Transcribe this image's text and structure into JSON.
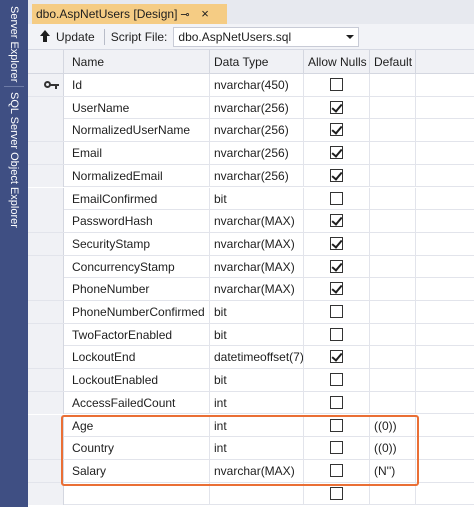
{
  "side_panel": {
    "tabs": [
      "Server Explorer",
      "SQL Server Object Explorer"
    ]
  },
  "document_tab": {
    "title": "dbo.AspNetUsers [Design]",
    "pin_glyph": "⊸",
    "close_glyph": "×"
  },
  "toolbar": {
    "update_label": "Update",
    "script_file_label": "Script File:",
    "script_file_value": "dbo.AspNetUsers.sql"
  },
  "grid": {
    "columns": [
      "Name",
      "Data Type",
      "Allow Nulls",
      "Default"
    ],
    "rows": [
      {
        "name": "Id",
        "type": "nvarchar(450)",
        "allow_nulls": false,
        "default": "",
        "primary_key": true
      },
      {
        "name": "UserName",
        "type": "nvarchar(256)",
        "allow_nulls": true,
        "default": ""
      },
      {
        "name": "NormalizedUserName",
        "type": "nvarchar(256)",
        "allow_nulls": true,
        "default": ""
      },
      {
        "name": "Email",
        "type": "nvarchar(256)",
        "allow_nulls": true,
        "default": ""
      },
      {
        "name": "NormalizedEmail",
        "type": "nvarchar(256)",
        "allow_nulls": true,
        "default": ""
      },
      {
        "name": "EmailConfirmed",
        "type": "bit",
        "allow_nulls": false,
        "default": ""
      },
      {
        "name": "PasswordHash",
        "type": "nvarchar(MAX)",
        "allow_nulls": true,
        "default": ""
      },
      {
        "name": "SecurityStamp",
        "type": "nvarchar(MAX)",
        "allow_nulls": true,
        "default": ""
      },
      {
        "name": "ConcurrencyStamp",
        "type": "nvarchar(MAX)",
        "allow_nulls": true,
        "default": ""
      },
      {
        "name": "PhoneNumber",
        "type": "nvarchar(MAX)",
        "allow_nulls": true,
        "default": ""
      },
      {
        "name": "PhoneNumberConfirmed",
        "type": "bit",
        "allow_nulls": false,
        "default": ""
      },
      {
        "name": "TwoFactorEnabled",
        "type": "bit",
        "allow_nulls": false,
        "default": ""
      },
      {
        "name": "LockoutEnd",
        "type": "datetimeoffset(7)",
        "allow_nulls": true,
        "default": ""
      },
      {
        "name": "LockoutEnabled",
        "type": "bit",
        "allow_nulls": false,
        "default": ""
      },
      {
        "name": "AccessFailedCount",
        "type": "int",
        "allow_nulls": false,
        "default": ""
      },
      {
        "name": "Age",
        "type": "int",
        "allow_nulls": false,
        "default": "((0))"
      },
      {
        "name": "Country",
        "type": "int",
        "allow_nulls": false,
        "default": "((0))"
      },
      {
        "name": "Salary",
        "type": "nvarchar(MAX)",
        "allow_nulls": false,
        "default": "(N'')"
      },
      {
        "name": "",
        "type": "",
        "allow_nulls": false,
        "default": ""
      }
    ]
  },
  "colors": {
    "side_panel": "#3f4f83",
    "active_tab": "#f5cc84",
    "highlight_border": "#ea6f35"
  },
  "icons": {
    "update": "up-arrow-icon",
    "primary_key": "key-icon",
    "dropdown": "chevron-down-icon"
  }
}
